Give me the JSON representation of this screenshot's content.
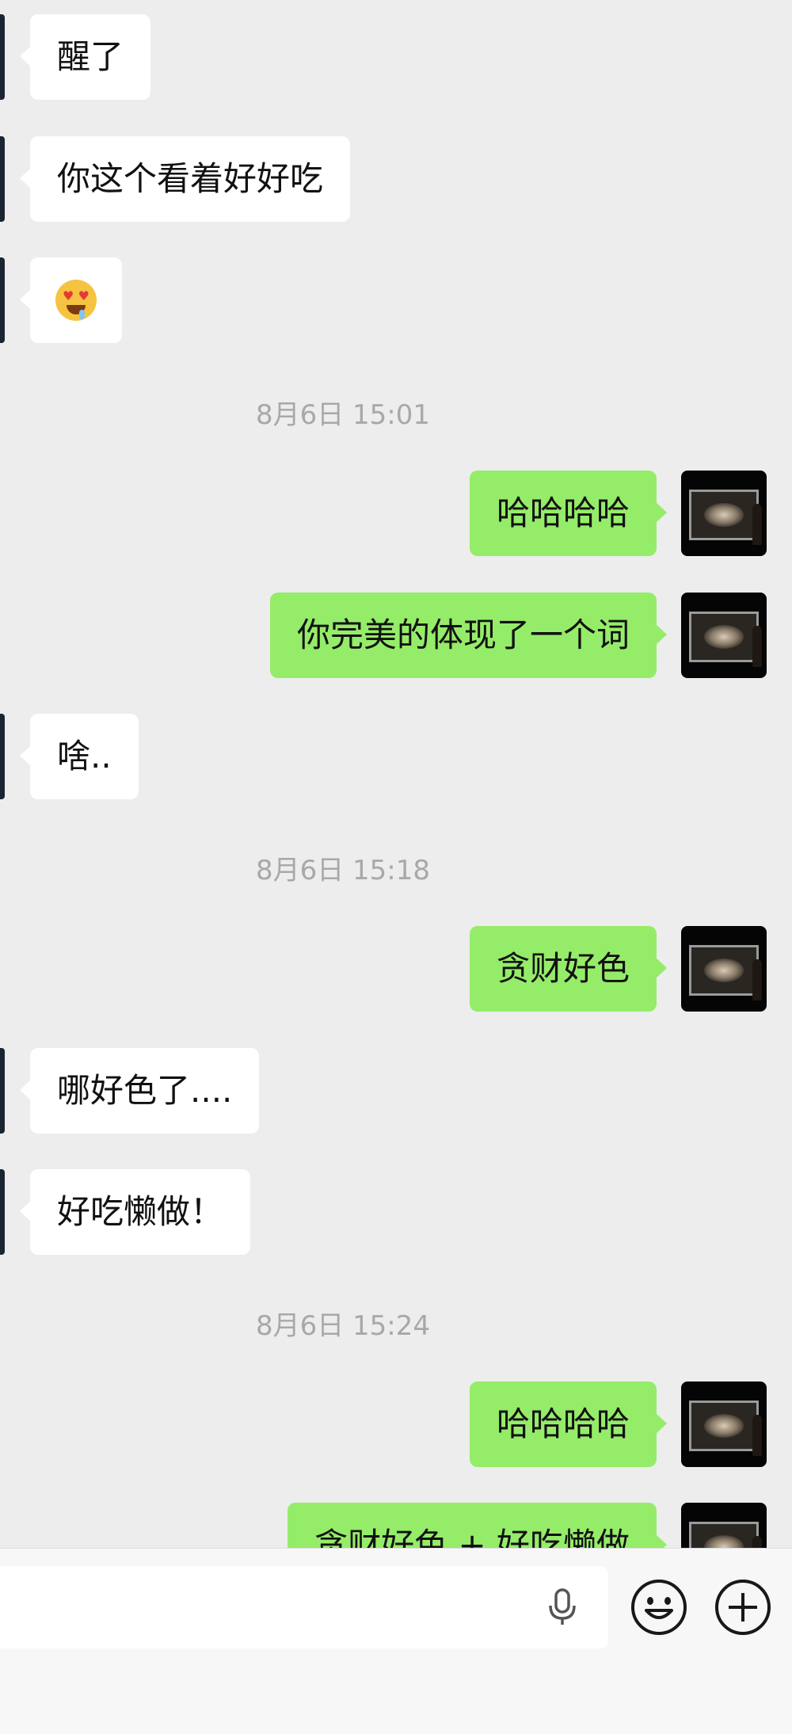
{
  "messages": [
    {
      "kind": "in",
      "text": "醒了"
    },
    {
      "kind": "in",
      "text": "你这个看着好好吃"
    },
    {
      "kind": "in",
      "emoji": "heart-eyes-drooling-face"
    },
    {
      "kind": "time",
      "text": "8月6日 15:01"
    },
    {
      "kind": "out",
      "text": "哈哈哈哈"
    },
    {
      "kind": "out",
      "text": "你完美的体现了一个词"
    },
    {
      "kind": "in",
      "text": "啥.."
    },
    {
      "kind": "time",
      "text": "8月6日 15:18"
    },
    {
      "kind": "out",
      "text": "贪财好色"
    },
    {
      "kind": "in",
      "text": "哪好色了...."
    },
    {
      "kind": "in",
      "text": "好吃懒做！"
    },
    {
      "kind": "time",
      "text": "8月6日 15:24"
    },
    {
      "kind": "out",
      "text": "哈哈哈哈"
    },
    {
      "kind": "out",
      "text": "贪财好色 + 好吃懒做"
    }
  ],
  "input_bar": {
    "value": "",
    "icons": [
      "microphone-icon",
      "emoji-icon",
      "plus-icon"
    ]
  },
  "colors": {
    "background": "#ededed",
    "incoming_bubble": "#ffffff",
    "outgoing_bubble": "#95ec69",
    "timestamp_text": "#a8a8a8"
  }
}
